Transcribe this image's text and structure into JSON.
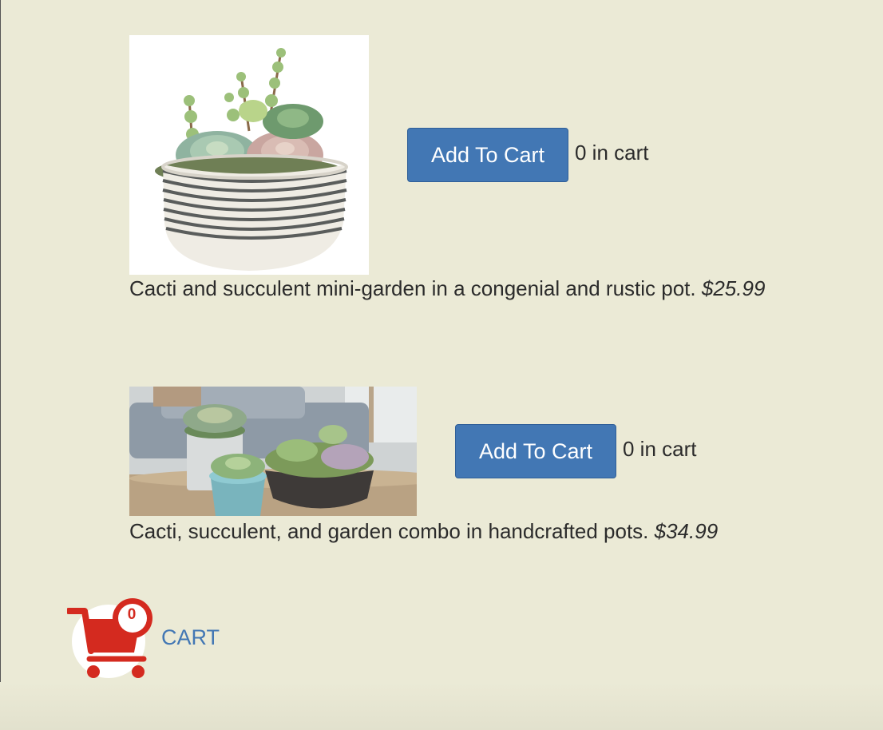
{
  "products": [
    {
      "image_alt": "succulent-bowl",
      "add_button_label": "Add To Cart",
      "in_cart_text": "0 in cart",
      "description": "Cacti and succulent mini-garden in a congenial and rustic pot.",
      "price": "$25.99"
    },
    {
      "image_alt": "succulent-combo",
      "add_button_label": "Add To Cart",
      "in_cart_text": "0 in cart",
      "description": "Cacti, succulent, and garden combo in handcrafted pots.",
      "price": "$34.99"
    }
  ],
  "cart": {
    "count": "0",
    "label": "CART",
    "icon": "shopping-cart-icon"
  },
  "colors": {
    "background": "#ebead6",
    "button": "#4277b4",
    "cart_red": "#d42a1f",
    "cart_label": "#4277b4"
  }
}
